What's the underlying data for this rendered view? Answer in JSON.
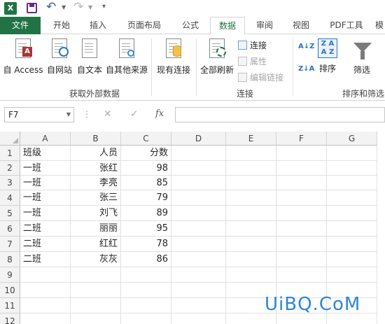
{
  "quick_access": {
    "app_icon": "excel-icon",
    "save_icon": "save-icon",
    "undo_icon": "undo-icon",
    "redo_icon": "redo-icon",
    "customize_icon": "customize-qat-icon",
    "app_letter": "X",
    "undo_glyph": "↶",
    "redo_glyph": "↷",
    "dropdown_glyph": "▼",
    "more_glyph": "▾"
  },
  "tabs": [
    {
      "label": "文件"
    },
    {
      "label": "开始"
    },
    {
      "label": "插入"
    },
    {
      "label": "页面布局"
    },
    {
      "label": "公式"
    },
    {
      "label": "数据"
    },
    {
      "label": "审阅"
    },
    {
      "label": "视图"
    },
    {
      "label": "PDF工具"
    },
    {
      "label": "模"
    }
  ],
  "active_tab": "数据",
  "colors": {
    "brand": "#217346",
    "access": "#a4373a",
    "link": "#2a73c6",
    "watermark": "#2e86d6"
  },
  "ribbon": {
    "get_external": {
      "group_label": "获取外部数据",
      "from_access": "自 Access",
      "from_access_badge": "A",
      "from_web": "自网站",
      "from_text": "自文本",
      "from_other": "自其他来源"
    },
    "existing_connections": "现有连接",
    "connections": {
      "group_label": "连接",
      "refresh_all": "全部刷新",
      "connections": "连接",
      "properties": "属性",
      "edit_links": "编辑链接"
    },
    "sort_filter": {
      "group_label": "排序和筛选",
      "sort_az": "A↓Z",
      "sort_za": "Z↓A",
      "sort": "排序",
      "sort_box": "Z A A Z",
      "filter": "筛选"
    }
  },
  "formula_bar": {
    "name_box": "F7",
    "dropdown_glyph": "▼",
    "dots": "⋮",
    "cancel": "✕",
    "enter": "✓",
    "fx": "fx",
    "formula": ""
  },
  "sheet": {
    "columns": [
      "A",
      "B",
      "C",
      "D",
      "E",
      "F",
      "G"
    ],
    "rows": [
      "1",
      "2",
      "3",
      "4",
      "5",
      "6",
      "7",
      "8",
      "9",
      "10",
      "11",
      "12"
    ],
    "cells": [
      [
        "班级",
        "人员",
        "分数"
      ],
      [
        "一班",
        "张红",
        "98"
      ],
      [
        "一班",
        "李亮",
        "85"
      ],
      [
        "一班",
        "张三",
        "79"
      ],
      [
        "一班",
        "刘飞",
        "89"
      ],
      [
        "二班",
        "丽丽",
        "95"
      ],
      [
        "二班",
        "红红",
        "78"
      ],
      [
        "二班",
        "灰灰",
        "86"
      ]
    ]
  },
  "watermark": "UiBQ.CoM"
}
